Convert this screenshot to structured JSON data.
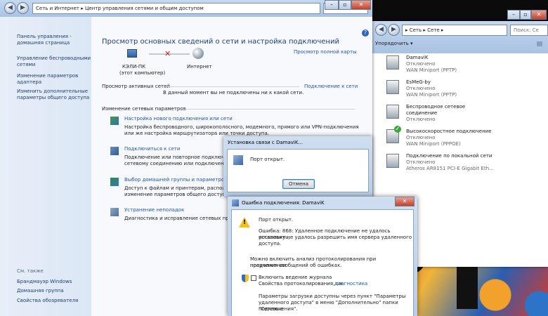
{
  "main": {
    "address": "Сеть и Интернет  ▸  Центр управления сетями и общим доступом",
    "search_placeholder": "",
    "sidebar": {
      "items": [
        "Панель управления -",
        "домашняя страница",
        "Управление беспроводными",
        "сетями",
        "Изменение параметров",
        "адаптера",
        "Изменить дополнительные",
        "параметры общего доступа"
      ],
      "see_also": "См. также",
      "see_also_items": [
        "Брандмауэр Windows",
        "Домашняя группа",
        "Свойства обозревателя"
      ]
    },
    "title": "Просмотр основных сведений о сети и настройка подключений",
    "full_map": "Просмотр полной карты",
    "computer_name": "КЭЛИ-ПК",
    "computer_sub": "(этот компьютер)",
    "internet": "Интернет",
    "active_networks": "Просмотр активных сетей",
    "connect_link": "Подключение к сети",
    "not_connected": "В данный момент вы не подключены ни к какой сети.",
    "change_header": "Изменение сетевых параметров",
    "tasks": [
      {
        "title": "Настройка нового подключения или сети",
        "d1": "Настройка беспроводного, широкополосного, модемного, прямого или VPN-подключения",
        "d2": "или же настройка маршрутизатора или точки доступа."
      },
      {
        "title": "Подключиться к сети",
        "d1": "Подключение или повторное подключение",
        "d2": "сетевому соединению или подключение"
      },
      {
        "title": "Выбор домашней группы и параметров",
        "d1": "Доступ к файлам и принтерам, располож",
        "d2": "изменение параметров общего доступа."
      },
      {
        "title": "Устранение неполадок",
        "d1": "Диагностика и исправление сетевых пробл",
        "d2": ""
      }
    ]
  },
  "explorer": {
    "address": "▸ Сеть ▸ Сете ▸",
    "search": "Поиск: Се",
    "organize": "Упорядочить ▾",
    "connections": [
      {
        "name": "DamaviK",
        "status": "Отключено",
        "device": "WAN Miniport (PPTP)",
        "ok": false
      },
      {
        "name": "EsMeG-by",
        "status": "Отключено",
        "device": "WAN Miniport (PPTP)",
        "ok": false
      },
      {
        "name": "Беспроводное сетевое",
        "status": "соединение",
        "device": "Отключено",
        "ok": false
      },
      {
        "name": "Высокоскоростное подключение",
        "status": "Отключено",
        "device": "WAN Miniport (PPPOE)",
        "ok": true
      },
      {
        "name": "Подключение по локальной сети",
        "status": "Отключено",
        "device": "Atheros AR8151 PCI-E Gigabit Eth...",
        "ok": false
      }
    ]
  },
  "dialog1": {
    "title": "Установка связи с DamaviK...",
    "message": "Порт открыт.",
    "cancel": "Отмена"
  },
  "dialog2": {
    "title": "Ошибка подключения: DamaviK",
    "message": "Порт открыт.",
    "err1": "Ошибка: 868: Удаленное подключение не удалось установить,",
    "err2": "поскольку не удалось разрешить имя сервера удаленного",
    "err3": "доступа.",
    "q1": "Можно включить анализ протоколирования при продолжении",
    "q2": "получения сообщений об ошибках.",
    "log_label": "Включить ведение журнала",
    "log_sub": "Свойства протоколирования, см.",
    "diag_link": "диагностика",
    "p1": "Параметры загрузки доступны через пункт \"Параметры",
    "p2": "удаленного доступа\" в меню \"Дополнительно\" папки \"Сетевые",
    "p3": "подключения\"."
  }
}
